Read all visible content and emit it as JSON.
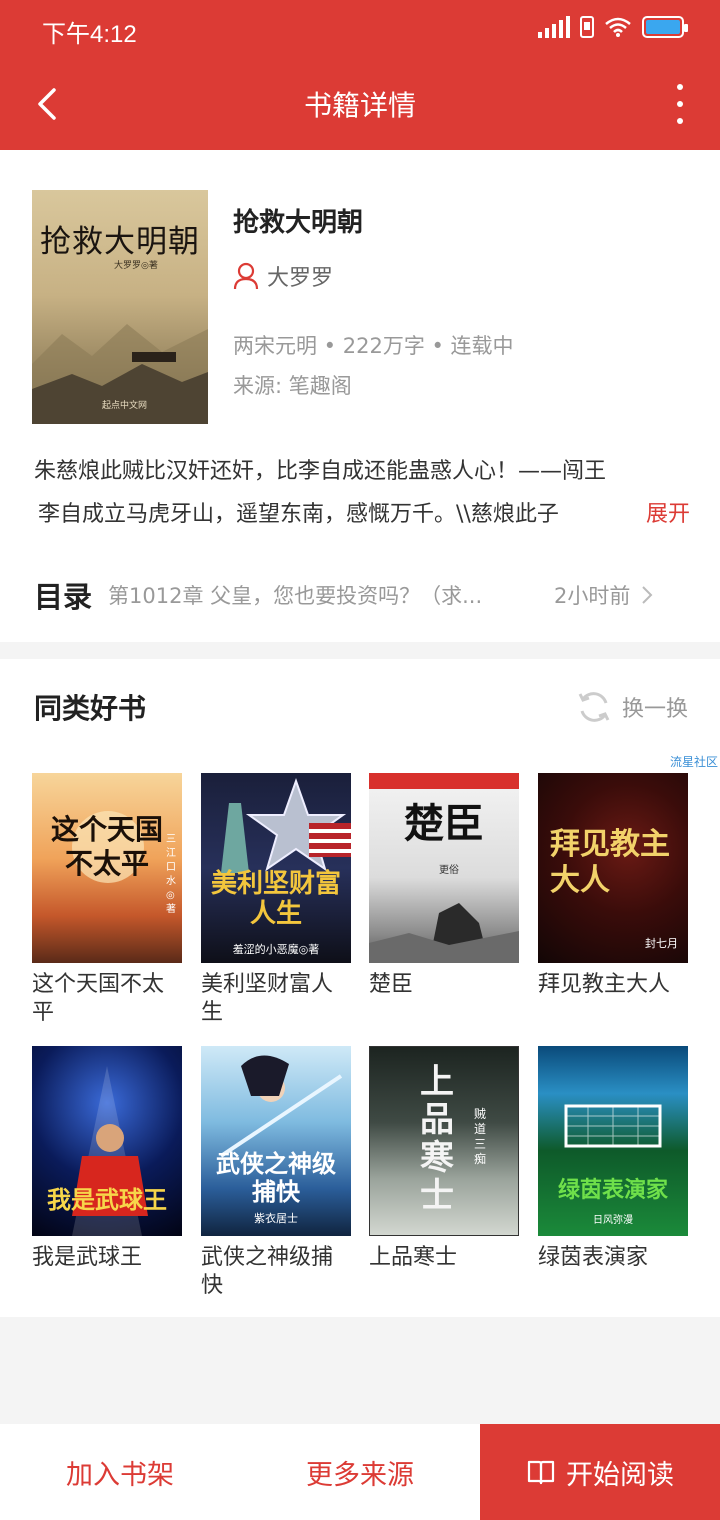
{
  "status": {
    "time": "下午4:12"
  },
  "nav": {
    "title": "书籍详情"
  },
  "book": {
    "title": "抢救大明朝",
    "author": "大罗罗",
    "meta": "两宋元明 • 222万字 • 连载中",
    "source": "来源: 笔趣阁",
    "cover_text": "抢救大明朝",
    "cover_sub": "大罗罗◎著",
    "cover_brand": "起点中文网",
    "desc_line1": "朱慈烺此贼比汉奸还奸，比李自成还能蛊惑人心！——闯王",
    "desc_line2": "李自成立马虎牙山，遥望东南，感慨万千。\\\\慈烺此子",
    "expand_label": "展开"
  },
  "toc": {
    "label": "目录",
    "latest_chapter": "第1012章 父皇，您也要投资吗？（求...",
    "updated": "2小时前"
  },
  "similar": {
    "heading": "同类好书",
    "refresh_label": "换一换",
    "watermark": "流星社区",
    "books": [
      {
        "name": "这个天国不太平",
        "cover_text": "这个天国不太平",
        "cover_author": "三江口水◎著"
      },
      {
        "name": "美利坚财富人生",
        "cover_text": "美利坚财富人生",
        "cover_author": "羞涩的小恶魔◎著"
      },
      {
        "name": "楚臣",
        "cover_text": "楚臣",
        "cover_author": "更俗"
      },
      {
        "name": "拜见教主大人",
        "cover_text": "拜见教主大人",
        "cover_author": "封七月"
      },
      {
        "name": "我是武球王",
        "cover_text": "我是武球王",
        "cover_author": ""
      },
      {
        "name": "武侠之神级捕快",
        "cover_text": "武侠之神级捕快",
        "cover_author": "紫衣居士"
      },
      {
        "name": "上品寒士",
        "cover_text": "上品寒士",
        "cover_author": "贼道三痴"
      },
      {
        "name": "绿茵表演家",
        "cover_text": "绿茵表演家",
        "cover_author": "日风弥漫"
      }
    ]
  },
  "bottom": {
    "add_shelf": "加入书架",
    "more_sources": "更多来源",
    "start_reading": "开始阅读"
  },
  "colors": {
    "accent": "#dc3b35",
    "battery": "#3aa7ef"
  }
}
